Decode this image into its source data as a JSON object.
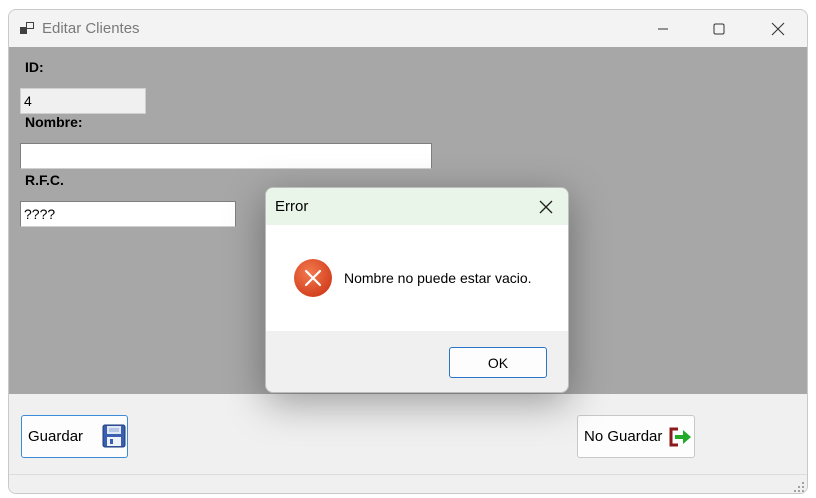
{
  "window": {
    "title": "Editar Clientes",
    "icons": {
      "app": "app-window-icon",
      "minimize": "minimize-icon",
      "maximize": "maximize-icon",
      "close": "close-icon"
    }
  },
  "form": {
    "id_label": "ID:",
    "id_value": "4",
    "nombre_label": "Nombre:",
    "nombre_value": "",
    "rfc_label": "R.F.C.",
    "rfc_value": "????"
  },
  "buttons": {
    "save_label": "Guardar",
    "save_icon": "floppy-disk-icon",
    "nosave_label": "No Guardar",
    "nosave_icon": "exit-arrow-icon"
  },
  "dialog": {
    "title": "Error",
    "message": "Nombre no puede estar vacio.",
    "ok_label": "OK",
    "icon": "error-icon"
  },
  "colors": {
    "client_area": "#a7a7a7",
    "dialog_title_bg": "#e9f5e9",
    "accent_border": "#2a75c8",
    "error_red": "#e4532c",
    "exit_green": "#22aa2a",
    "exit_darkred": "#8b1a1a"
  }
}
